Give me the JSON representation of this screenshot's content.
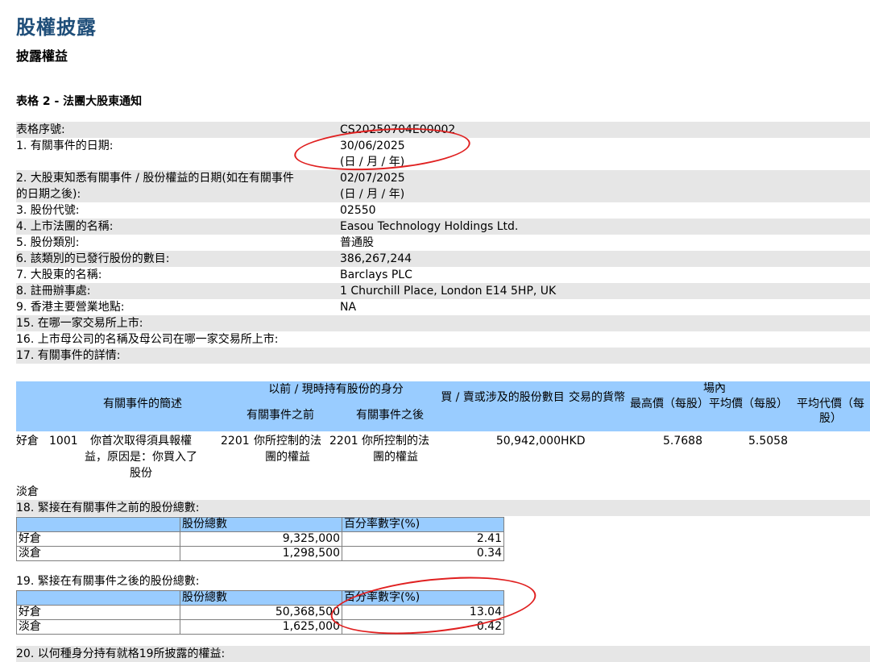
{
  "page": {
    "title": "股權披露",
    "subtitle": "披露權益",
    "form_title": "表格 2 - 法團大股東通知"
  },
  "info": [
    {
      "label": "表格序號:",
      "value": "CS20250704E00002",
      "note": ""
    },
    {
      "label": "1. 有關事件的日期:",
      "value": "30/06/2025",
      "note": "(日 / 月 / 年)"
    },
    {
      "label": "2. 大股東知悉有關事件 / 股份權益的日期(如在有關事件",
      "label2": "的日期之後):",
      "value": "02/07/2025",
      "note": "(日 / 月 / 年)"
    },
    {
      "label": "3. 股份代號:",
      "value": "02550"
    },
    {
      "label": "4. 上市法團的名稱:",
      "value": "Easou Technology Holdings Ltd."
    },
    {
      "label": "5. 股份類別:",
      "value": "普通股"
    },
    {
      "label": "6. 該類別的已發行股份的數目:",
      "value": "386,267,244"
    },
    {
      "label": "7. 大股東的名稱:",
      "value": "Barclays PLC"
    },
    {
      "label": "8. 註冊辦事處:",
      "value": "1 Churchill Place, London E14 5HP, UK"
    },
    {
      "label": "9. 香港主要營業地點:",
      "value": "NA"
    },
    {
      "label": "15. 在哪一家交易所上市:",
      "value": ""
    },
    {
      "label": "16. 上市母公司的名稱及母公司在哪一家交易所上市:",
      "value": ""
    },
    {
      "label": "17. 有關事件的詳情:",
      "value": ""
    }
  ],
  "details_table": {
    "headers": {
      "description": "有關事件的簡述",
      "capacity_group": "以前 / 現時持有股份的身分",
      "before": "有關事件之前",
      "after": "有關事件之後",
      "shares": "買 / 賣或涉及的股份數目",
      "currency": "交易的貨幣",
      "onexchange": "場內",
      "highest": "最高價（每股）",
      "average": "平均價（每股）",
      "avg_consideration": "平均代價（每股）"
    },
    "row": {
      "position": "好倉",
      "code": "1001",
      "description": "你首次取得須具報權益，原因是：你買入了股份",
      "before_code": "2201",
      "before_text": "你所控制的法團的權益",
      "after_code": "2201",
      "after_text": "你所控制的法團的權益",
      "shares": "50,942,000",
      "currency": "HKD",
      "highest": "5.7688",
      "average": "5.5058"
    }
  },
  "short_label": "淡倉",
  "section18": {
    "title": "18. 緊接在有關事件之前的股份總數:",
    "col_total": "股份總數",
    "col_pct": "百分率數字(%)",
    "rows": [
      {
        "label": "好倉",
        "total": "9,325,000",
        "pct": "2.41"
      },
      {
        "label": "淡倉",
        "total": "1,298,500",
        "pct": "0.34"
      }
    ]
  },
  "section19": {
    "title": "19. 緊接在有關事件之後的股份總數:",
    "col_total": "股份總數",
    "col_pct": "百分率數字(%)",
    "rows": [
      {
        "label": "好倉",
        "total": "50,368,500",
        "pct": "13.04"
      },
      {
        "label": "淡倉",
        "total": "1,625,000",
        "pct": "0.42"
      }
    ]
  },
  "section20_title": "20. 以何種身分持有就格19所披露的權益:",
  "colors": {
    "title": "#1f4e79",
    "header_bg": "#99ccff",
    "row_bg": "#e6e6e6",
    "annotation": "#e02020"
  }
}
